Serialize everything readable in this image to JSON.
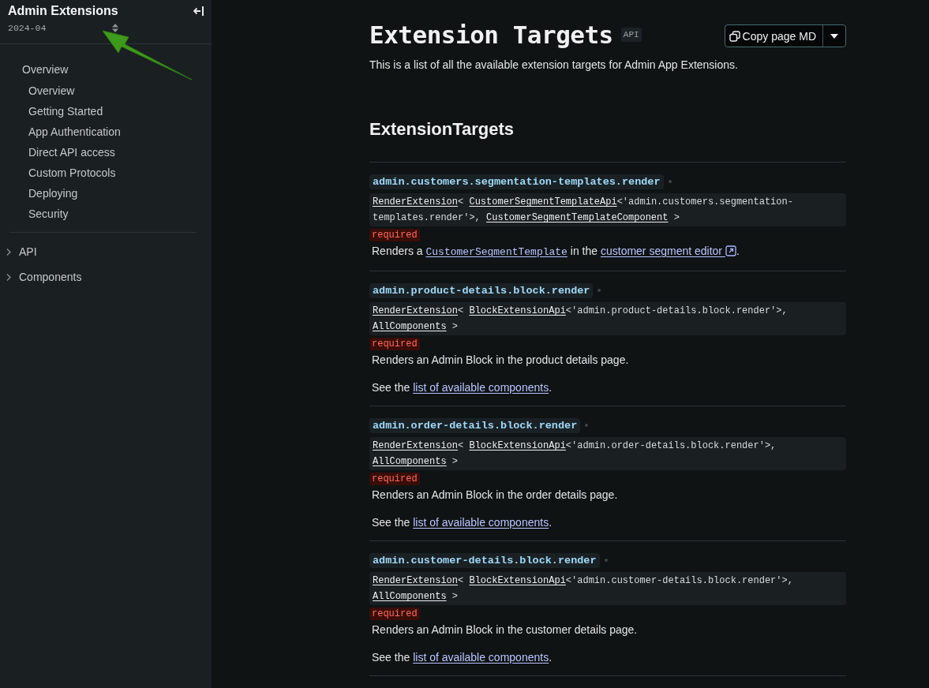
{
  "sidebar": {
    "title": "Admin Extensions",
    "version": "2024-04",
    "group": {
      "label": "Overview",
      "items": [
        "Overview",
        "Getting Started",
        "App Authentication",
        "Direct API access",
        "Custom Protocols",
        "Deploying",
        "Security"
      ]
    },
    "sections": [
      {
        "label": "API",
        "expanded": false
      },
      {
        "label": "Components",
        "expanded": false
      }
    ]
  },
  "page": {
    "title": "Extension Targets",
    "badge": "API",
    "copy_button": "Copy page MD",
    "intro": "This is a list of all the available extension targets for Admin App Extensions.",
    "section_title": "ExtensionTargets"
  },
  "targets": [
    {
      "name": "admin.customers.segmentation-templates.render",
      "signature": [
        {
          "kind": "type",
          "text": "RenderExtension"
        },
        {
          "kind": "code",
          "text": "< "
        },
        {
          "kind": "type",
          "text": "CustomerSegmentTemplateApi"
        },
        {
          "kind": "code",
          "text": "<'admin.customers.segmentation-templates.render'>, "
        },
        {
          "kind": "type",
          "text": "CustomerSegmentTemplateComponent"
        },
        {
          "kind": "code",
          "text": " >"
        }
      ],
      "required": "required",
      "description": [
        {
          "kind": "text",
          "text": "Renders a "
        },
        {
          "kind": "code-link",
          "text": "CustomerSegmentTemplate"
        },
        {
          "kind": "text",
          "text": " in the "
        },
        {
          "kind": "external-link",
          "text": "customer segment editor"
        },
        {
          "kind": "text",
          "text": "."
        }
      ]
    },
    {
      "name": "admin.product-details.block.render",
      "signature": [
        {
          "kind": "type",
          "text": "RenderExtension"
        },
        {
          "kind": "code",
          "text": "< "
        },
        {
          "kind": "type",
          "text": "BlockExtensionApi"
        },
        {
          "kind": "code",
          "text": "<'admin.product-details.block.render'>, "
        },
        {
          "kind": "type",
          "text": "AllComponents"
        },
        {
          "kind": "code",
          "text": " >"
        }
      ],
      "required": "required",
      "description": [
        {
          "kind": "text",
          "text": "Renders an Admin Block in the product details page."
        }
      ],
      "see_also": [
        {
          "kind": "text",
          "text": "See the "
        },
        {
          "kind": "link",
          "text": "list of available components"
        },
        {
          "kind": "text",
          "text": "."
        }
      ]
    },
    {
      "name": "admin.order-details.block.render",
      "signature": [
        {
          "kind": "type",
          "text": "RenderExtension"
        },
        {
          "kind": "code",
          "text": "< "
        },
        {
          "kind": "type",
          "text": "BlockExtensionApi"
        },
        {
          "kind": "code",
          "text": "<'admin.order-details.block.render'>, "
        },
        {
          "kind": "type",
          "text": "AllComponents"
        },
        {
          "kind": "code",
          "text": " >"
        }
      ],
      "required": "required",
      "description": [
        {
          "kind": "text",
          "text": "Renders an Admin Block in the order details page."
        }
      ],
      "see_also": [
        {
          "kind": "text",
          "text": "See the "
        },
        {
          "kind": "link",
          "text": "list of available components"
        },
        {
          "kind": "text",
          "text": "."
        }
      ]
    },
    {
      "name": "admin.customer-details.block.render",
      "signature": [
        {
          "kind": "type",
          "text": "RenderExtension"
        },
        {
          "kind": "code",
          "text": "< "
        },
        {
          "kind": "type",
          "text": "BlockExtensionApi"
        },
        {
          "kind": "code",
          "text": "<'admin.customer-details.block.render'>, "
        },
        {
          "kind": "type",
          "text": "AllComponents"
        },
        {
          "kind": "code",
          "text": " >"
        }
      ],
      "required": "required",
      "description": [
        {
          "kind": "text",
          "text": "Renders an Admin Block in the customer details page."
        }
      ],
      "see_also": [
        {
          "kind": "text",
          "text": "See the "
        },
        {
          "kind": "link",
          "text": "list of available components"
        },
        {
          "kind": "text",
          "text": "."
        }
      ]
    }
  ]
}
